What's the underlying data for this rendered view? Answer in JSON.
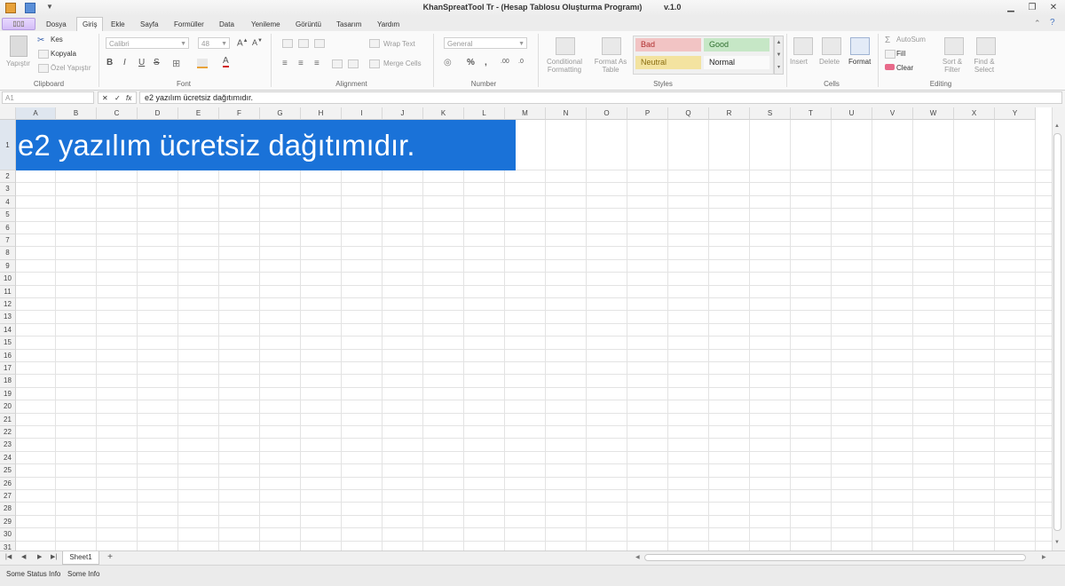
{
  "window": {
    "title": "KhanSpreatTool  Tr - (Hesap Tablosu Oluşturma Programı)",
    "version": "v.1.0",
    "minimize": "▁",
    "restore": "❐",
    "close": "✕"
  },
  "tabs": [
    "Dosya",
    "Giriş",
    "Ekle",
    "Sayfa",
    "Formüller",
    "Data",
    "Yenileme",
    "Görüntü",
    "Tasarım",
    "Yardım"
  ],
  "active_tab": "Giriş",
  "ribbon": {
    "clipboard": {
      "label": "Clipboard",
      "paste": "Yapıştır",
      "cut": "Kes",
      "copy": "Kopyala",
      "paste_special": "Özel Yapıştır"
    },
    "font": {
      "label": "Font",
      "family": "Calibri",
      "size": "48"
    },
    "alignment": {
      "label": "Alignment",
      "wrap": "Wrap Text",
      "merge": "Merge Cells"
    },
    "number": {
      "label": "Number",
      "format": "General"
    },
    "styles": {
      "label": "Styles",
      "conditional": "Conditional Formatting",
      "format_table": "Format As Table",
      "bad": "Bad",
      "good": "Good",
      "neutral": "Neutral",
      "normal": "Normal"
    },
    "cells": {
      "label": "Cells",
      "insert": "Insert",
      "delete": "Delete",
      "format": "Format"
    },
    "editing": {
      "label": "Editing",
      "autosum": "AutoSum",
      "fill": "Fill",
      "clear": "Clear",
      "sort": "Sort & Filter",
      "find": "Find & Select"
    }
  },
  "formula_bar": {
    "name_box": "A1",
    "cancel": "✕",
    "enter": "✓",
    "fx": "fx",
    "content": "e2 yazılım ücretsiz dağıtımıdır."
  },
  "columns": [
    "A",
    "B",
    "C",
    "D",
    "E",
    "F",
    "G",
    "H",
    "I",
    "J",
    "K",
    "L",
    "M",
    "N",
    "O",
    "P",
    "Q",
    "R",
    "S",
    "T",
    "U",
    "V",
    "W",
    "X",
    "Y"
  ],
  "rows": [
    "1",
    "2",
    "3",
    "4",
    "5",
    "6",
    "7",
    "8",
    "9",
    "10",
    "11",
    "12",
    "13",
    "14",
    "15",
    "16",
    "17",
    "18",
    "19",
    "20",
    "21",
    "22",
    "23",
    "24",
    "25",
    "26",
    "27",
    "28",
    "29",
    "30",
    "31"
  ],
  "cell_a1": "e2 yazılım ücretsiz dağıtımıdır.",
  "sheet_tabs": [
    "Sheet1"
  ],
  "add_sheet": "+",
  "status": {
    "item1": "Some Status Info",
    "item2": "Some Info"
  },
  "colors": {
    "selection": "#1a72d8",
    "bad_bg": "#f2c4c4",
    "good_bg": "#c6e7c6",
    "neutral_bg": "#f3e3a0"
  }
}
